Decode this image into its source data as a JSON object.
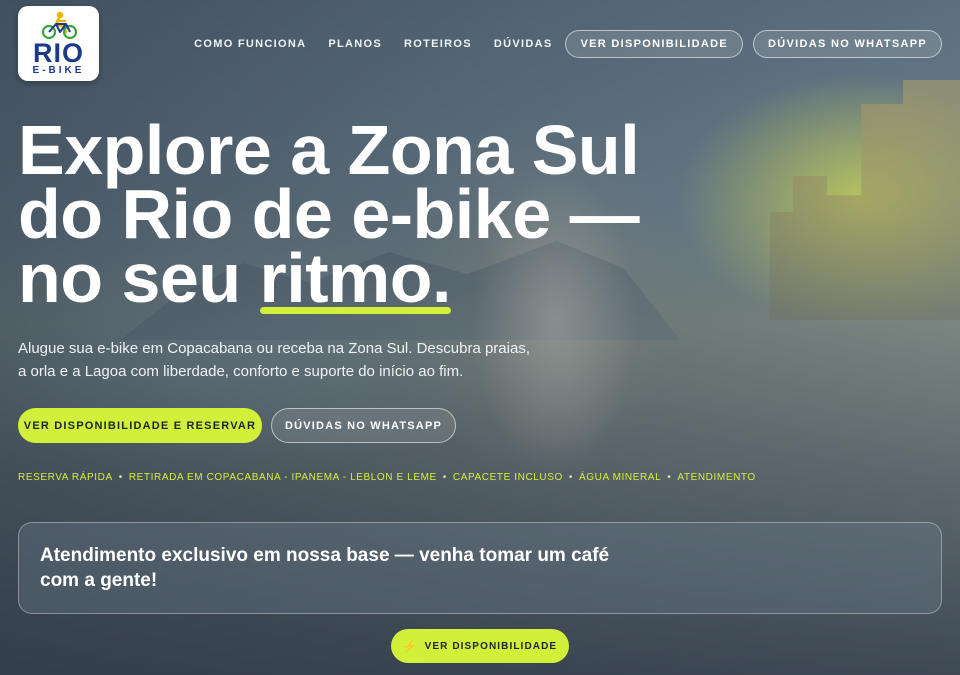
{
  "brand": {
    "logo_word": "RIO",
    "logo_sub": "E-BIKE",
    "colors": {
      "primary": "#1b3a8a",
      "accent": "#d2ef3a",
      "bike_green": "#3aa63a",
      "rider_yellow": "#f2b400"
    }
  },
  "nav": {
    "links": [
      "COMO FUNCIONA",
      "PLANOS",
      "ROTEIROS",
      "DÚVIDAS"
    ],
    "availability_button": "VER DISPONIBILIDADE",
    "whatsapp_button": "DÚVIDAS NO WHATSAPP"
  },
  "hero": {
    "title_line1": "Explore a Zona Sul",
    "title_line2": "do Rio de e-bike —",
    "title_line3_prefix": "no seu ",
    "title_highlight": "ritmo",
    "title_suffix": ".",
    "lede": "Alugue sua e-bike em Copacabana ou receba na Zona Sul. Descubra praias, a orla e a Lagoa com liberdade, conforto e suporte do início ao fim.",
    "cta_primary": "VER DISPONIBILIDADE E RESERVAR",
    "cta_secondary": "DÚVIDAS NO WHATSAPP"
  },
  "features": [
    "RESERVA RÁPIDA",
    "RETIRADA EM COPACABANA - IPANEMA - LEBLON E LEME",
    "CAPACETE INCLUSO",
    "ÁGUA MINERAL",
    "ATENDIMENTO"
  ],
  "panel": {
    "text": "Atendimento exclusivo em nossa base — venha tomar um café com a gente!"
  },
  "floating_cta": {
    "icon": "bolt-icon",
    "label": "VER DISPONIBILIDADE"
  }
}
